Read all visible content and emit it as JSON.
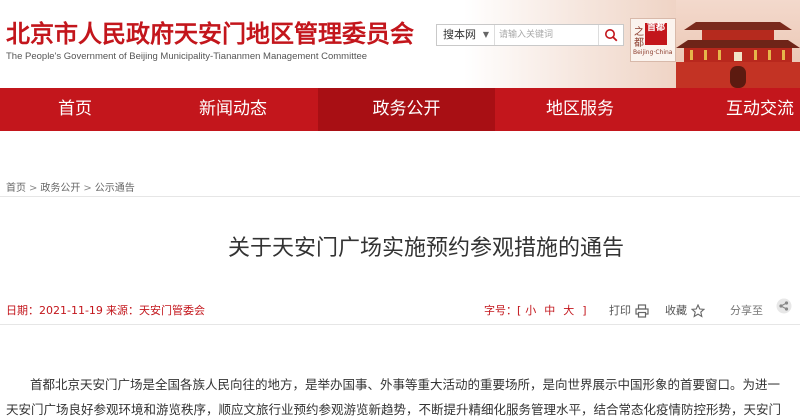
{
  "header": {
    "title": "北京市人民政府天安门地区管理委员会",
    "subtitle": "The People's Government of Beijing Municipality-Tiananmen Management Committee",
    "logo_chars": [
      "之",
      "都"
    ],
    "logo_seal": "首都",
    "logo_caption": "Beijing·China",
    "accent_color": "#c3161c"
  },
  "search": {
    "scope": "搜本网",
    "placeholder": "请输入关键词",
    "button_icon": "search-icon"
  },
  "nav": {
    "items": [
      {
        "label": "首页"
      },
      {
        "label": "新闻动态"
      },
      {
        "label": "政务公开"
      },
      {
        "label": "地区服务"
      },
      {
        "label": "互动交流"
      }
    ],
    "active_index": 2
  },
  "breadcrumb": {
    "items": [
      "首页",
      "政务公开",
      "公示通告"
    ],
    "separator": ">"
  },
  "article": {
    "title": "关于天安门广场实施预约参观措施的通告",
    "date": "日期：2021-11-19",
    "source": "来源：天安门管委会",
    "font_size_label": "字号：[",
    "font_sizes": [
      "小",
      "中",
      "大",
      "]"
    ],
    "print_label": "打印",
    "print_icon": "printer-icon",
    "favorite_label": "收藏",
    "favorite_icon": "star-icon",
    "share_label": "分享至",
    "share_icon": "share-icon",
    "paragraphs": [
      "首都北京天安门广场是全国各族人民向往的地方，是举办国事、外事等重大活动的重要场所，是向世界展示中国形象的首要窗口。为进一",
      "天安门广场良好参观环境和游览秩序，顺应文旅行业预约参观游览新趋势，不断提升精细化服务管理水平，结合常态化疫情防控形势，天安门"
    ]
  }
}
